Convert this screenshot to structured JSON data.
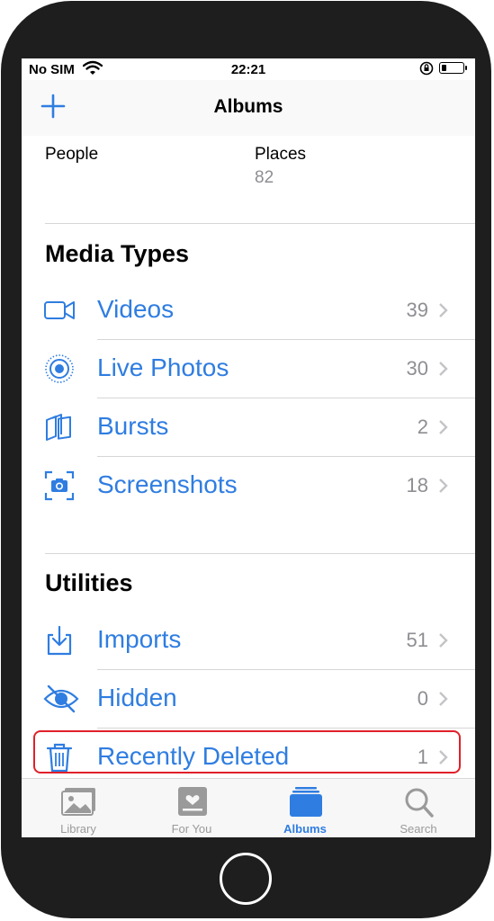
{
  "status": {
    "carrier": "No SIM",
    "time": "22:21"
  },
  "navbar": {
    "title": "Albums"
  },
  "people": {
    "label": "People"
  },
  "places": {
    "label": "Places",
    "count": "82"
  },
  "media_types": {
    "title": "Media Types",
    "items": [
      {
        "label": "Videos",
        "count": "39",
        "icon": "video-camera-icon"
      },
      {
        "label": "Live Photos",
        "count": "30",
        "icon": "live-photos-icon"
      },
      {
        "label": "Bursts",
        "count": "2",
        "icon": "bursts-icon"
      },
      {
        "label": "Screenshots",
        "count": "18",
        "icon": "screenshot-icon"
      }
    ]
  },
  "utilities": {
    "title": "Utilities",
    "items": [
      {
        "label": "Imports",
        "count": "51",
        "icon": "import-icon"
      },
      {
        "label": "Hidden",
        "count": "0",
        "icon": "eye-slash-icon"
      },
      {
        "label": "Recently Deleted",
        "count": "1",
        "icon": "trash-icon"
      }
    ]
  },
  "tabbar": {
    "tabs": [
      {
        "label": "Library",
        "icon": "photo-library-icon"
      },
      {
        "label": "For You",
        "icon": "for-you-icon"
      },
      {
        "label": "Albums",
        "icon": "albums-icon",
        "active": true
      },
      {
        "label": "Search",
        "icon": "search-icon"
      }
    ]
  },
  "colors": {
    "accent": "#2f7de1",
    "highlight": "#e0202a",
    "bezel": "#1e1e1e",
    "secondary": "#8e8e93"
  }
}
